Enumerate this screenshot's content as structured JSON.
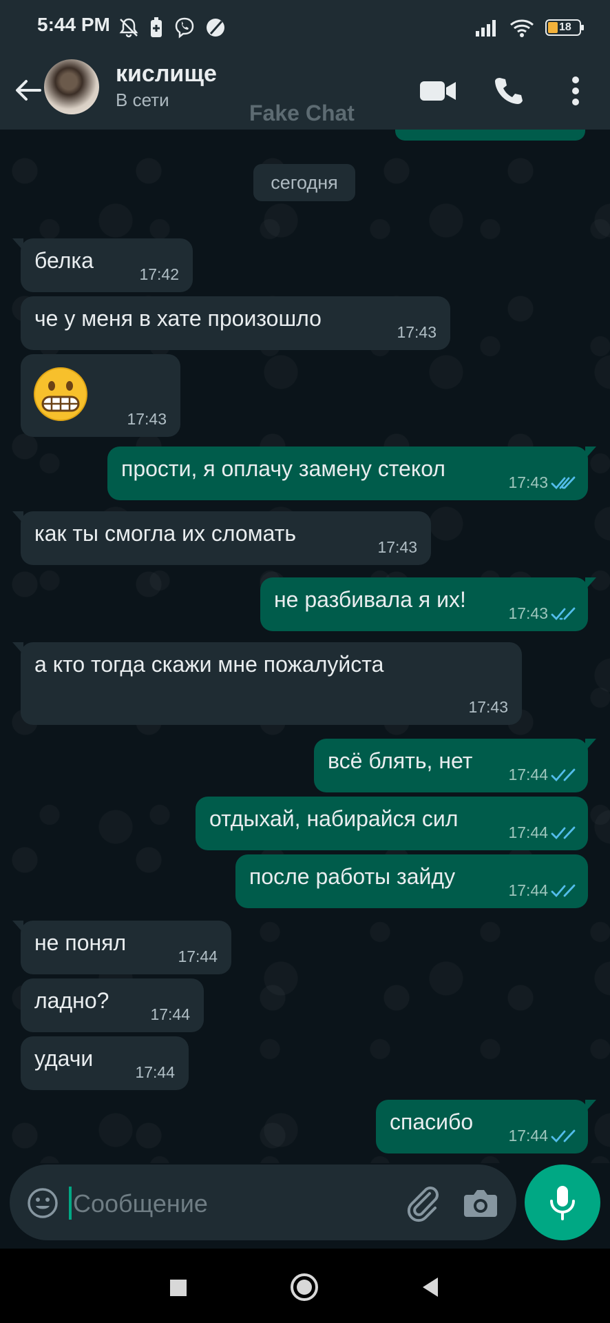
{
  "status_bar": {
    "time": "5:44 PM",
    "battery": "18"
  },
  "header": {
    "contact_name": "кислище",
    "contact_status": "В сети",
    "watermark": "Fake Chat"
  },
  "chat": {
    "date_label": "сегодня",
    "messages": [
      {
        "dir": "in",
        "text": "белка",
        "time": "17:42"
      },
      {
        "dir": "in",
        "text": "че у меня в хате произошло",
        "time": "17:43"
      },
      {
        "dir": "in",
        "text": "",
        "emoji": "grimacing-face",
        "time": "17:43"
      },
      {
        "dir": "out",
        "text": "прости, я оплачу замену стекол",
        "time": "17:43",
        "status": "read"
      },
      {
        "dir": "in",
        "text": "как ты смогла их сломать",
        "time": "17:43"
      },
      {
        "dir": "out",
        "text": "не разбивала я их!",
        "time": "17:43",
        "status": "read"
      },
      {
        "dir": "in",
        "text": "а кто тогда скажи мне пожалуйста",
        "time": "17:43"
      },
      {
        "dir": "out",
        "text": "всё блять, нет",
        "time": "17:44",
        "status": "read"
      },
      {
        "dir": "out",
        "text": "отдыхай, набирайся сил",
        "time": "17:44",
        "status": "read"
      },
      {
        "dir": "out",
        "text": "после работы зайду",
        "time": "17:44",
        "status": "read"
      },
      {
        "dir": "in",
        "text": "не понял",
        "time": "17:44"
      },
      {
        "dir": "in",
        "text": "ладно?",
        "time": "17:44"
      },
      {
        "dir": "in",
        "text": "удачи",
        "time": "17:44"
      },
      {
        "dir": "out",
        "text": "спасибо",
        "time": "17:44",
        "status": "read"
      }
    ]
  },
  "composer": {
    "placeholder": "Сообщение"
  },
  "colors": {
    "background": "#0b141a",
    "bar": "#1f2c33",
    "incoming": "#1f2c33",
    "outgoing": "#005c4b",
    "accent": "#00a884",
    "read_ticks": "#53bdeb"
  },
  "icons": {
    "header": [
      "back-arrow-icon",
      "video-call-icon",
      "voice-call-icon",
      "more-options-icon"
    ],
    "composer": [
      "emoji-icon",
      "attach-icon",
      "camera-icon",
      "mic-icon"
    ],
    "nav": [
      "recents-icon",
      "home-icon",
      "back-icon"
    ]
  }
}
